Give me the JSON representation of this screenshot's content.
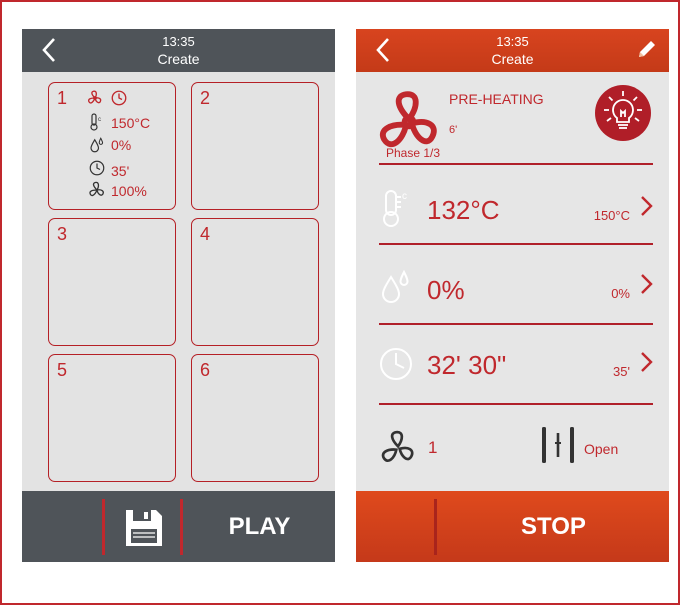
{
  "colors": {
    "accent": "#c0282d",
    "dark_header": "#4f5459",
    "orange_header": "#d8441f",
    "panel": "#e3e3e3"
  },
  "left_screen": {
    "header": {
      "time": "13:35",
      "title": "Create",
      "back_icon": "chevron-left-icon"
    },
    "phases": [
      {
        "number": "1",
        "temperature": "150°C",
        "humidity": "0%",
        "time": "35'",
        "fan": "100%"
      },
      {
        "number": "2"
      },
      {
        "number": "3"
      },
      {
        "number": "4"
      },
      {
        "number": "5"
      },
      {
        "number": "6"
      }
    ],
    "footer": {
      "save_icon": "floppy-disk-icon",
      "play_label": "PLAY"
    }
  },
  "right_screen": {
    "header": {
      "time": "13:35",
      "title": "Create",
      "back_icon": "chevron-left-icon",
      "edit_icon": "pencil-icon"
    },
    "status": {
      "state": "PRE-HEATING",
      "minutes": "6'",
      "phase": "Phase 1/3",
      "fan_icon": "fan-icon",
      "light_icon": "light-bulb-icon"
    },
    "temperature": {
      "current": "132°C",
      "set": "150°C"
    },
    "humidity": {
      "current": "0%",
      "set": "0%"
    },
    "time": {
      "current": "32' 30\"",
      "set": "35'"
    },
    "fan": {
      "speed": "1"
    },
    "vent": {
      "label": "Open"
    },
    "footer": {
      "stop_label": "STOP"
    }
  }
}
